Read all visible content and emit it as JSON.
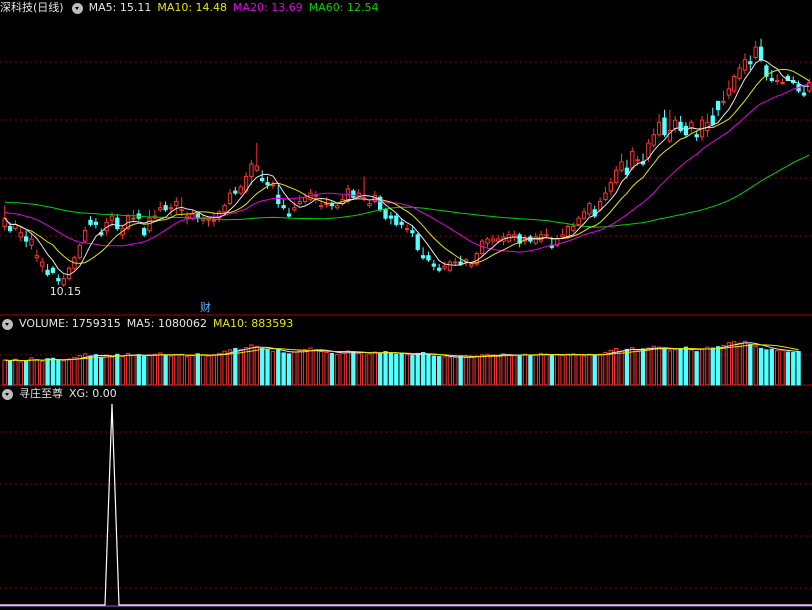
{
  "colors": {
    "up": "#ff3232",
    "down": "#54ffff",
    "ma5": "#e6e6e6",
    "ma10": "#e6e600",
    "ma20": "#e600e6",
    "ma60": "#00d200",
    "grid": "#8a0000",
    "separator": "#b40000",
    "signal": "#ffffff"
  },
  "price_panel": {
    "stock_name": "深科技",
    "period": "(日线)",
    "ma5_label": "MA5:",
    "ma5_value": "15.11",
    "ma10_label": "MA10:",
    "ma10_value": "14.48",
    "ma20_label": "MA20:",
    "ma20_value": "13.69",
    "ma60_label": "MA60:",
    "ma60_value": "12.54",
    "low_marker": "10.15",
    "event_marker": "财"
  },
  "volume_panel": {
    "title": "VOLUME:",
    "value": "1759315",
    "ma5_label": "MA5:",
    "ma5_value": "1080062",
    "ma10_label": "MA10:",
    "ma10_value": "883593"
  },
  "indicator_panel": {
    "title": "寻庄至尊",
    "xg_label": "XG:",
    "xg_value": "0.00"
  },
  "chart_data": [
    {
      "type": "candlestick",
      "title": "深科技(日线)",
      "price_range": [
        9.5,
        16.5
      ],
      "min_low_label": 10.15,
      "candles": [
        [
          11.55,
          11.75,
          12.05,
          11.45
        ],
        [
          11.55,
          11.45,
          11.65,
          11.4
        ],
        [
          11.5,
          11.6,
          11.7,
          11.45
        ],
        [
          11.3,
          11.4,
          11.55,
          11.2
        ],
        [
          11.3,
          11.2,
          11.45,
          11.05
        ],
        [
          11.1,
          11.25,
          11.4,
          11.0
        ],
        [
          10.8,
          10.85,
          11.0,
          10.7
        ],
        [
          10.6,
          10.7,
          10.8,
          10.45
        ],
        [
          10.5,
          10.4,
          10.65,
          10.35
        ],
        [
          10.55,
          10.45,
          10.6,
          10.4
        ],
        [
          10.3,
          10.25,
          10.4,
          10.15
        ],
        [
          10.15,
          10.3,
          10.4,
          10.1
        ],
        [
          10.3,
          10.55,
          10.6,
          10.25
        ],
        [
          10.55,
          10.8,
          10.85,
          10.5
        ],
        [
          10.8,
          11.1,
          11.15,
          10.75
        ],
        [
          11.2,
          11.45,
          11.55,
          11.15
        ],
        [
          11.7,
          11.6,
          11.8,
          11.55
        ],
        [
          11.65,
          11.6,
          11.75,
          11.5
        ],
        [
          11.4,
          11.35,
          11.5,
          11.3
        ],
        [
          11.45,
          11.65,
          11.75,
          11.35
        ],
        [
          11.7,
          11.8,
          11.9,
          11.55
        ],
        [
          11.75,
          11.5,
          11.85,
          11.45
        ],
        [
          11.35,
          11.5,
          11.6,
          11.25
        ],
        [
          11.5,
          11.8,
          11.85,
          11.45
        ],
        [
          11.75,
          11.75,
          11.95,
          11.65
        ],
        [
          11.85,
          11.75,
          11.95,
          11.7
        ],
        [
          11.5,
          11.35,
          11.55,
          11.3
        ],
        [
          11.45,
          11.75,
          11.95,
          11.4
        ],
        [
          11.75,
          11.8,
          11.95,
          11.75
        ],
        [
          11.95,
          12.0,
          12.15,
          11.9
        ],
        [
          12.05,
          11.95,
          12.15,
          11.9
        ],
        [
          12.0,
          12.0,
          12.1,
          11.8
        ],
        [
          12.05,
          12.15,
          12.25,
          11.85
        ],
        [
          11.95,
          11.95,
          12.25,
          11.8
        ],
        [
          11.75,
          11.8,
          11.9,
          11.6
        ],
        [
          11.75,
          11.85,
          11.95,
          11.7
        ],
        [
          11.85,
          11.75,
          11.9,
          11.65
        ],
        [
          11.7,
          11.75,
          11.85,
          11.6
        ],
        [
          11.7,
          11.75,
          11.75,
          11.55
        ],
        [
          11.7,
          11.7,
          11.9,
          11.55
        ],
        [
          11.75,
          11.9,
          11.95,
          11.65
        ],
        [
          11.9,
          12.05,
          12.1,
          11.85
        ],
        [
          12.1,
          12.35,
          12.45,
          12.05
        ],
        [
          12.4,
          12.35,
          12.5,
          12.3
        ],
        [
          12.35,
          12.5,
          12.55,
          12.3
        ],
        [
          12.4,
          12.75,
          12.85,
          12.35
        ],
        [
          12.75,
          13.05,
          13.15,
          12.55
        ],
        [
          12.9,
          13.0,
          13.55,
          12.85
        ],
        [
          12.7,
          12.65,
          12.9,
          12.6
        ],
        [
          12.6,
          12.55,
          12.75,
          12.45
        ],
        [
          12.55,
          12.55,
          12.65,
          12.45
        ],
        [
          12.3,
          12.1,
          12.55,
          12.0
        ],
        [
          12.05,
          12.0,
          12.2,
          11.95
        ],
        [
          11.85,
          11.8,
          12.0,
          11.75
        ],
        [
          11.95,
          12.0,
          12.15,
          11.9
        ],
        [
          12.1,
          12.15,
          12.3,
          12.05
        ],
        [
          12.15,
          12.25,
          12.35,
          12.1
        ],
        [
          12.2,
          12.35,
          12.45,
          12.15
        ],
        [
          12.3,
          12.3,
          12.4,
          12.1
        ],
        [
          12.05,
          12.05,
          12.2,
          11.95
        ],
        [
          12.1,
          12.1,
          12.25,
          12.0
        ],
        [
          12.1,
          12.05,
          12.15,
          11.95
        ],
        [
          12.0,
          12.05,
          12.1,
          11.95
        ],
        [
          12.1,
          12.2,
          12.3,
          12.05
        ],
        [
          12.15,
          12.45,
          12.55,
          12.1
        ],
        [
          12.4,
          12.25,
          12.45,
          12.2
        ],
        [
          12.3,
          12.35,
          12.45,
          12.25
        ],
        [
          12.25,
          12.25,
          12.75,
          12.15
        ],
        [
          12.05,
          12.1,
          12.2,
          12.0
        ],
        [
          12.15,
          12.3,
          12.4,
          12.1
        ],
        [
          12.25,
          11.95,
          12.3,
          11.9
        ],
        [
          11.95,
          11.75,
          12.0,
          11.7
        ],
        [
          11.8,
          11.75,
          11.9,
          11.6
        ],
        [
          11.8,
          11.6,
          11.85,
          11.55
        ],
        [
          11.65,
          11.6,
          11.75,
          11.5
        ],
        [
          11.5,
          11.5,
          11.6,
          11.4
        ],
        [
          11.45,
          11.4,
          11.55,
          11.3
        ],
        [
          11.35,
          11.0,
          11.4,
          10.95
        ],
        [
          10.85,
          10.8,
          11.05,
          10.75
        ],
        [
          10.85,
          10.75,
          10.95,
          10.7
        ],
        [
          10.65,
          10.6,
          10.75,
          10.5
        ],
        [
          10.55,
          10.5,
          10.65,
          10.45
        ],
        [
          10.55,
          10.6,
          10.7,
          10.5
        ],
        [
          10.5,
          10.7,
          10.75,
          10.45
        ],
        [
          10.7,
          10.7,
          10.8,
          10.6
        ],
        [
          10.7,
          10.65,
          10.85,
          10.6
        ],
        [
          10.7,
          10.75,
          10.8,
          10.6
        ],
        [
          10.6,
          10.65,
          10.7,
          10.55
        ],
        [
          10.65,
          10.9,
          10.95,
          10.6
        ],
        [
          10.9,
          11.2,
          11.25,
          10.85
        ],
        [
          11.15,
          11.25,
          11.3,
          11.05
        ],
        [
          11.2,
          11.25,
          11.35,
          11.1
        ],
        [
          11.2,
          11.25,
          11.35,
          11.15
        ],
        [
          11.2,
          11.3,
          11.4,
          11.1
        ],
        [
          11.2,
          11.35,
          11.45,
          11.15
        ],
        [
          11.3,
          11.35,
          11.45,
          11.2
        ],
        [
          11.35,
          11.15,
          11.4,
          11.05
        ],
        [
          11.2,
          11.25,
          11.35,
          11.1
        ],
        [
          11.3,
          11.2,
          11.35,
          11.15
        ],
        [
          11.15,
          11.3,
          11.4,
          11.1
        ],
        [
          11.2,
          11.35,
          11.45,
          11.15
        ],
        [
          11.35,
          11.35,
          11.5,
          11.25
        ],
        [
          11.1,
          11.05,
          11.3,
          11.0
        ],
        [
          11.1,
          11.25,
          11.35,
          11.05
        ],
        [
          11.3,
          11.35,
          11.5,
          11.25
        ],
        [
          11.3,
          11.55,
          11.6,
          11.25
        ],
        [
          11.45,
          11.55,
          11.65,
          11.4
        ],
        [
          11.6,
          11.75,
          11.8,
          11.55
        ],
        [
          11.75,
          11.9,
          12.0,
          11.7
        ],
        [
          11.85,
          12.1,
          12.15,
          11.8
        ],
        [
          11.95,
          11.8,
          12.05,
          11.75
        ],
        [
          11.95,
          12.15,
          12.25,
          11.9
        ],
        [
          12.2,
          12.35,
          12.5,
          12.15
        ],
        [
          12.4,
          12.6,
          12.7,
          12.3
        ],
        [
          12.6,
          12.9,
          13.0,
          12.55
        ],
        [
          12.9,
          13.1,
          13.3,
          12.85
        ],
        [
          12.95,
          12.8,
          13.15,
          12.7
        ],
        [
          12.95,
          13.35,
          13.45,
          12.9
        ],
        [
          13.15,
          13.15,
          13.25,
          13.0
        ],
        [
          13.1,
          13.05,
          13.3,
          13.0
        ],
        [
          13.2,
          13.55,
          13.65,
          13.1
        ],
        [
          13.5,
          13.75,
          13.9,
          13.45
        ],
        [
          13.75,
          14.05,
          14.25,
          13.7
        ],
        [
          14.15,
          13.75,
          14.35,
          13.7
        ],
        [
          13.6,
          13.85,
          14.35,
          13.55
        ],
        [
          13.9,
          14.1,
          14.2,
          13.8
        ],
        [
          14.05,
          13.85,
          14.2,
          13.8
        ],
        [
          13.95,
          13.75,
          14.05,
          13.7
        ],
        [
          13.9,
          14.05,
          14.1,
          13.8
        ],
        [
          13.75,
          13.7,
          13.85,
          13.6
        ],
        [
          13.7,
          14.1,
          14.2,
          13.6
        ],
        [
          13.85,
          14.05,
          14.25,
          13.7
        ],
        [
          14.2,
          14.0,
          14.4,
          13.95
        ],
        [
          14.55,
          14.35,
          14.55,
          14.2
        ],
        [
          14.55,
          14.55,
          14.8,
          14.45
        ],
        [
          14.7,
          14.85,
          15.05,
          14.6
        ],
        [
          14.8,
          15.15,
          15.2,
          14.75
        ],
        [
          15.1,
          15.35,
          15.45,
          15.05
        ],
        [
          15.3,
          15.55,
          15.7,
          15.2
        ],
        [
          15.5,
          15.45,
          15.65,
          15.3
        ],
        [
          15.6,
          15.85,
          16.0,
          15.55
        ],
        [
          15.85,
          15.55,
          16.05,
          15.5
        ],
        [
          15.4,
          15.15,
          15.45,
          15.05
        ],
        [
          15.1,
          15.05,
          15.3,
          15.0
        ],
        [
          15.05,
          15.05,
          15.2,
          14.95
        ],
        [
          15.0,
          15.0,
          15.1,
          14.95
        ],
        [
          15.15,
          15.05,
          15.2,
          15.05
        ],
        [
          15.05,
          15.0,
          15.15,
          14.95
        ],
        [
          14.95,
          14.8,
          15.05,
          14.75
        ],
        [
          14.75,
          14.7,
          14.9,
          14.65
        ],
        [
          14.8,
          15.0,
          15.1,
          14.75
        ]
      ]
    },
    {
      "type": "bar",
      "title": "VOLUME",
      "ylim": [
        0,
        11000000
      ],
      "values": [
        5600000,
        5400000,
        5800000,
        5200000,
        5500000,
        6100000,
        5700000,
        5300000,
        5900000,
        6000000,
        5600000,
        5400000,
        5800000,
        6200000,
        6600000,
        7000000,
        6500000,
        6800000,
        6200000,
        6700000,
        6300000,
        6900000,
        6400000,
        7100000,
        6700000,
        6800000,
        6500000,
        6600000,
        6900000,
        7200000,
        6700000,
        6500000,
        6800000,
        6900000,
        6400000,
        6600000,
        7000000,
        6700000,
        6500000,
        6800000,
        7100000,
        7600000,
        7900000,
        8200000,
        8000000,
        8400000,
        9000000,
        8700000,
        8200000,
        7900000,
        7500000,
        7900000,
        7200000,
        7000000,
        7400000,
        7700000,
        8000000,
        8300000,
        7900000,
        7500000,
        7300000,
        7100000,
        6900000,
        7200000,
        7600000,
        7400000,
        7100000,
        7300000,
        7000000,
        7400000,
        7200000,
        7500000,
        7100000,
        6900000,
        7000000,
        6800000,
        6600000,
        7100000,
        7300000,
        6800000,
        6500000,
        6400000,
        6300000,
        6100000,
        6200000,
        6400000,
        6200000,
        6300000,
        6500000,
        6800000,
        6900000,
        6700000,
        6600000,
        7000000,
        6800000,
        6600000,
        6700000,
        6900000,
        6600000,
        6800000,
        7100000,
        6900000,
        6700000,
        6800000,
        6600000,
        6900000,
        7000000,
        6800000,
        6500000,
        6900000,
        6700000,
        6900000,
        7300000,
        7800000,
        8200000,
        7600000,
        8000000,
        8400000,
        7700000,
        8100000,
        8300000,
        8700000,
        8500000,
        8100000,
        7700000,
        7900000,
        8200000,
        8500000,
        7900000,
        7500000,
        8100000,
        8500000,
        8300000,
        8600000,
        8900000,
        9500000,
        9700000,
        9400000,
        9800000,
        9100000,
        8600000,
        8200000,
        7900000,
        8000000,
        7700000,
        7800000,
        7400000,
        7300000,
        7500000
      ]
    },
    {
      "type": "line",
      "title": "寻庄至尊",
      "series": [
        {
          "name": "XG",
          "values": [
            0,
            0,
            0,
            0,
            0,
            0,
            0,
            0,
            0,
            0,
            0,
            0,
            0,
            0,
            0,
            0,
            0,
            0,
            0,
            0,
            1,
            0,
            0,
            0,
            0,
            0,
            0,
            0,
            0,
            0,
            0,
            0,
            0,
            0,
            0,
            0,
            0,
            0,
            0,
            0,
            0,
            0,
            0,
            0,
            0,
            0,
            0,
            0,
            0,
            0,
            0,
            0,
            0,
            0,
            0,
            0,
            0,
            0,
            0,
            0,
            0,
            0,
            0,
            0,
            0,
            0,
            0,
            0,
            0,
            0,
            0,
            0,
            0,
            0,
            0,
            0,
            0,
            0,
            0,
            0,
            0,
            0,
            0,
            0,
            0,
            0,
            0,
            0,
            0,
            0,
            0,
            0,
            0,
            0,
            0,
            0,
            0,
            0,
            0,
            0,
            0,
            0,
            0,
            0,
            0,
            0,
            0,
            0,
            0,
            0,
            0,
            0,
            0,
            0,
            0,
            0,
            0,
            0,
            0,
            0,
            0,
            0,
            0,
            0,
            0,
            0,
            0,
            0,
            0,
            0,
            0,
            0,
            0,
            0,
            0,
            0,
            0,
            0,
            0,
            0,
            0,
            0,
            0,
            0,
            0,
            0,
            0,
            0,
            0,
            0,
            0
          ]
        }
      ],
      "ylim": [
        0,
        1
      ]
    }
  ]
}
